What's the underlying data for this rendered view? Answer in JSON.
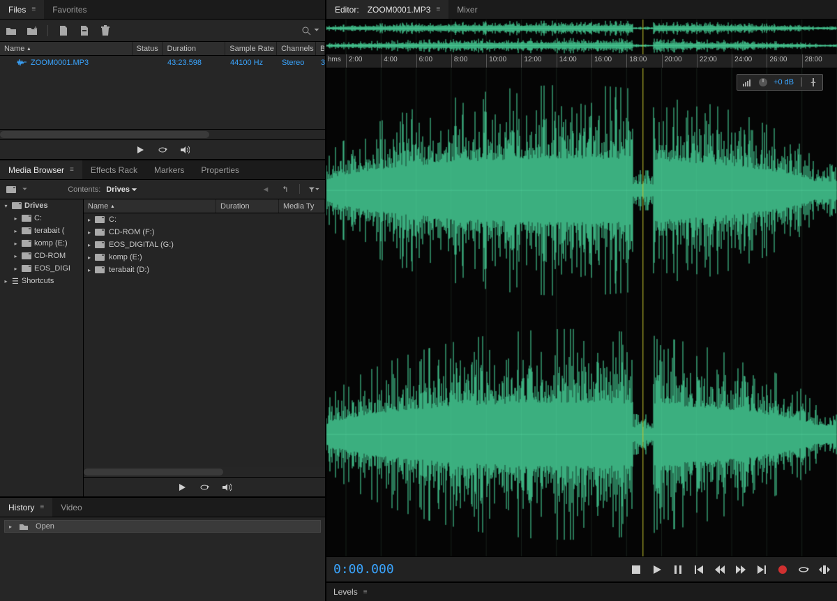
{
  "tabs_left_top": {
    "files": "Files",
    "favorites": "Favorites"
  },
  "files_columns": {
    "name": "Name",
    "status": "Status",
    "duration": "Duration",
    "sample_rate": "Sample Rate",
    "channels": "Channels",
    "bit": "Bi"
  },
  "file_row": {
    "name": "ZOOM0001.MP3",
    "duration": "43:23.598",
    "sample_rate": "44100 Hz",
    "channels": "Stereo",
    "bit": "3"
  },
  "media_tabs": {
    "browser": "Media Browser",
    "effects": "Effects Rack",
    "markers": "Markers",
    "properties": "Properties"
  },
  "media_toolbar": {
    "contents_label": "Contents:",
    "dropdown": "Drives"
  },
  "tree": {
    "root": "Drives",
    "items": [
      "C:",
      "terabait (",
      "komp (E:)",
      "CD-ROM",
      "EOS_DIGI"
    ],
    "shortcuts": "Shortcuts"
  },
  "contents_columns": {
    "name": "Name",
    "duration": "Duration",
    "media_type": "Media Ty"
  },
  "contents_items": [
    "C:",
    "CD-ROM (F:)",
    "EOS_DIGITAL (G:)",
    "komp (E:)",
    "terabait (D:)"
  ],
  "history_tabs": {
    "history": "History",
    "video": "Video"
  },
  "history_item": "Open",
  "editor_tabs": {
    "editor_prefix": "Editor:",
    "filename": "ZOOM0001.MP3",
    "mixer": "Mixer"
  },
  "ruler": {
    "hms": "hms",
    "ticks": [
      "2:00",
      "4:00",
      "6:00",
      "8:00",
      "10:00",
      "12:00",
      "14:00",
      "16:00",
      "18:00",
      "20:00",
      "22:00",
      "24:00",
      "26:00",
      "28:00"
    ]
  },
  "hud": {
    "db": "+0 dB"
  },
  "timecode": "0:00.000",
  "levels_label": "Levels",
  "colors": {
    "accent": "#3aa5ff",
    "wave": "#4ee8a8"
  }
}
